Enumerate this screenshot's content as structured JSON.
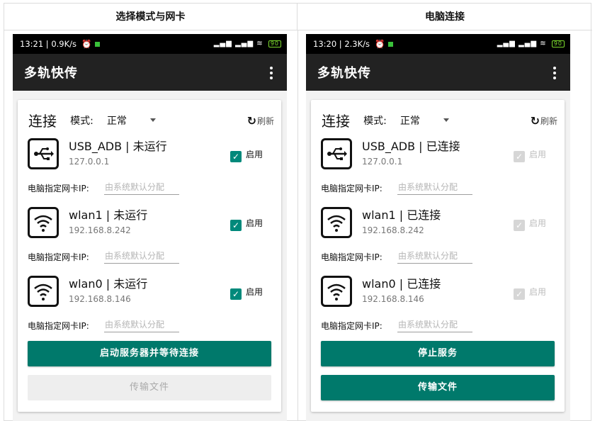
{
  "columns": {
    "left_header": "选择模式与网卡",
    "right_header": "电脑连接"
  },
  "colors": {
    "accent": "#00796b",
    "checkbox": "#00897b",
    "appbar": "#222222",
    "statusbar": "#000000"
  },
  "left": {
    "status": {
      "time_speed": "13:21 | 0.9K/s",
      "battery": "90"
    },
    "appbar": {
      "title": "多轨快传"
    },
    "card": {
      "title": "连接",
      "mode_label": "模式:",
      "mode_value": "正常",
      "refresh_label": "刷新",
      "ip_label": "电脑指定网卡IP:",
      "ip_placeholder": "由系统默认分配",
      "interfaces": [
        {
          "name": "USB_ADB | 未运行",
          "addr": "127.0.0.1",
          "enable_label": "启用",
          "icon": "usb-icon",
          "checked": true,
          "disabled": false
        },
        {
          "name": "wlan1 | 未运行",
          "addr": "192.168.8.242",
          "enable_label": "启用",
          "icon": "wifi-icon",
          "checked": true,
          "disabled": false
        },
        {
          "name": "wlan0 | 未运行",
          "addr": "192.168.8.146",
          "enable_label": "启用",
          "icon": "wifi-icon",
          "checked": true,
          "disabled": false
        }
      ],
      "primary_button": "启动服务器并等待连接",
      "secondary_button": "传输文件"
    }
  },
  "right": {
    "status": {
      "time_speed": "13:20 | 2.3K/s",
      "battery": "90"
    },
    "appbar": {
      "title": "多轨快传"
    },
    "card": {
      "title": "连接",
      "mode_label": "模式:",
      "mode_value": "正常",
      "refresh_label": "刷新",
      "ip_label": "电脑指定网卡IP:",
      "ip_placeholder": "由系统默认分配",
      "interfaces": [
        {
          "name": "USB_ADB | 已连接",
          "addr": "127.0.0.1",
          "enable_label": "启用",
          "icon": "usb-icon",
          "checked": true,
          "disabled": true
        },
        {
          "name": "wlan1 | 已连接",
          "addr": "192.168.8.242",
          "enable_label": "启用",
          "icon": "wifi-icon",
          "checked": true,
          "disabled": true
        },
        {
          "name": "wlan0 | 已连接",
          "addr": "192.168.8.146",
          "enable_label": "启用",
          "icon": "wifi-icon",
          "checked": true,
          "disabled": true
        }
      ],
      "primary_button": "停止服务",
      "secondary_button": "传输文件"
    }
  }
}
